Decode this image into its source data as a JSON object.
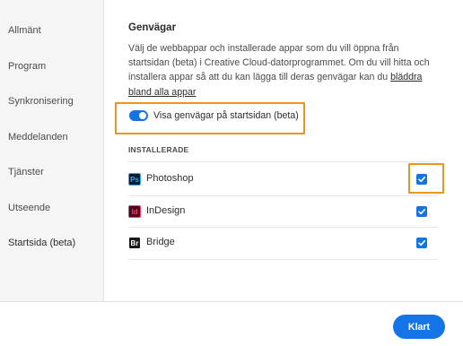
{
  "sidebar": {
    "items": [
      {
        "label": "Allmänt"
      },
      {
        "label": "Program"
      },
      {
        "label": "Synkronisering"
      },
      {
        "label": "Meddelanden"
      },
      {
        "label": "Tjänster"
      },
      {
        "label": "Utseende"
      },
      {
        "label": "Startsida (beta)",
        "active": true
      }
    ]
  },
  "main": {
    "title": "Genvägar",
    "description": "Välj de webbappar och installerade appar som du vill öppna från startsidan (beta) i Creative Cloud-datorprogrammet. Om du vill hitta och installera appar så att du kan lägga till deras genvägar kan du ",
    "description_link": "bläddra bland alla appar",
    "toggle": {
      "label": "Visa genvägar på startsidan (beta)",
      "on": true
    },
    "installed_heading": "INSTALLERADE",
    "apps": [
      {
        "abbr": "Ps",
        "name": "Photoshop",
        "icon_bg": "#001e36",
        "icon_fg": "#31a8ff",
        "checked": true
      },
      {
        "abbr": "Id",
        "name": "InDesign",
        "icon_bg": "#49021f",
        "icon_fg": "#ff3366",
        "checked": true
      },
      {
        "abbr": "Br",
        "name": "Bridge",
        "icon_bg": "#1a1a1a",
        "icon_fg": "#ffffff",
        "checked": true
      }
    ]
  },
  "footer": {
    "done_label": "Klart"
  },
  "colors": {
    "accent": "#1473e6",
    "highlight": "#e8961e"
  }
}
